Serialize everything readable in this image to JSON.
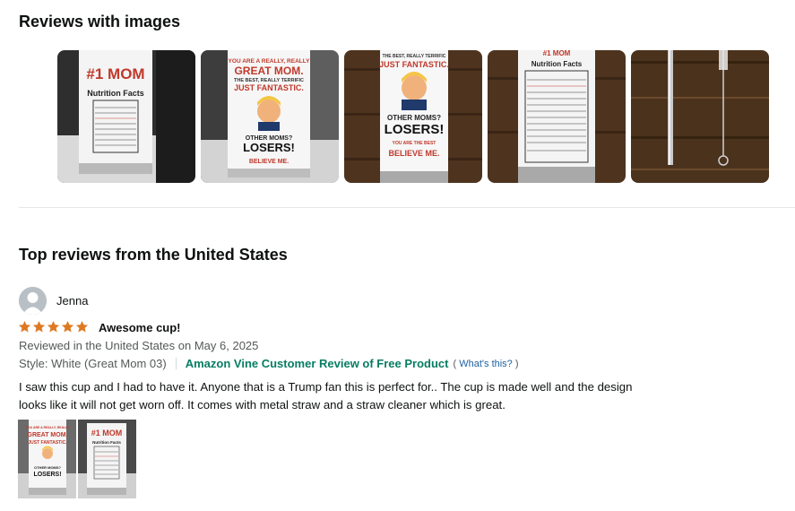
{
  "images_section": {
    "heading": "Reviews with images",
    "thumbnails": [
      {
        "name": "#1 MOM nutrition facts tumbler",
        "colors": {
          "bg": "#3a3a3a"
        }
      },
      {
        "name": "Great Mom tumbler front",
        "colors": {
          "bg": "#6a6a6a"
        }
      },
      {
        "name": "Great Mom tumbler on wood",
        "colors": {
          "bg": "#5a3b22"
        }
      },
      {
        "name": "Nutrition facts tumbler on wood",
        "colors": {
          "bg": "#5a3b22"
        }
      },
      {
        "name": "Metal straw and cleaner",
        "colors": {
          "bg": "#4b321d"
        }
      }
    ]
  },
  "top_reviews": {
    "heading": "Top reviews from the United States",
    "review": {
      "reviewer": "Jenna",
      "rating": 5,
      "title": "Awesome cup!",
      "reviewed_line": "Reviewed in the United States on May 6, 2025",
      "style": "Style: White (Great Mom 03)",
      "vine_label": "Amazon Vine Customer Review of Free Product",
      "whats_this_open": "(",
      "whats_this": "What's this?",
      "whats_this_close": ")",
      "body": "I saw this cup and I had to have it. Anyone that is a Trump fan this is perfect for.. The cup is made well and the design looks like it will not get worn off. It comes with metal straw and a straw cleaner which is great.",
      "images": [
        "Great Mom tumbler",
        "#1 MOM tumbler"
      ]
    }
  },
  "colors": {
    "star": "#de7921",
    "vine": "#067d62",
    "link": "#2162a1",
    "divider": "#e3e6e6"
  }
}
